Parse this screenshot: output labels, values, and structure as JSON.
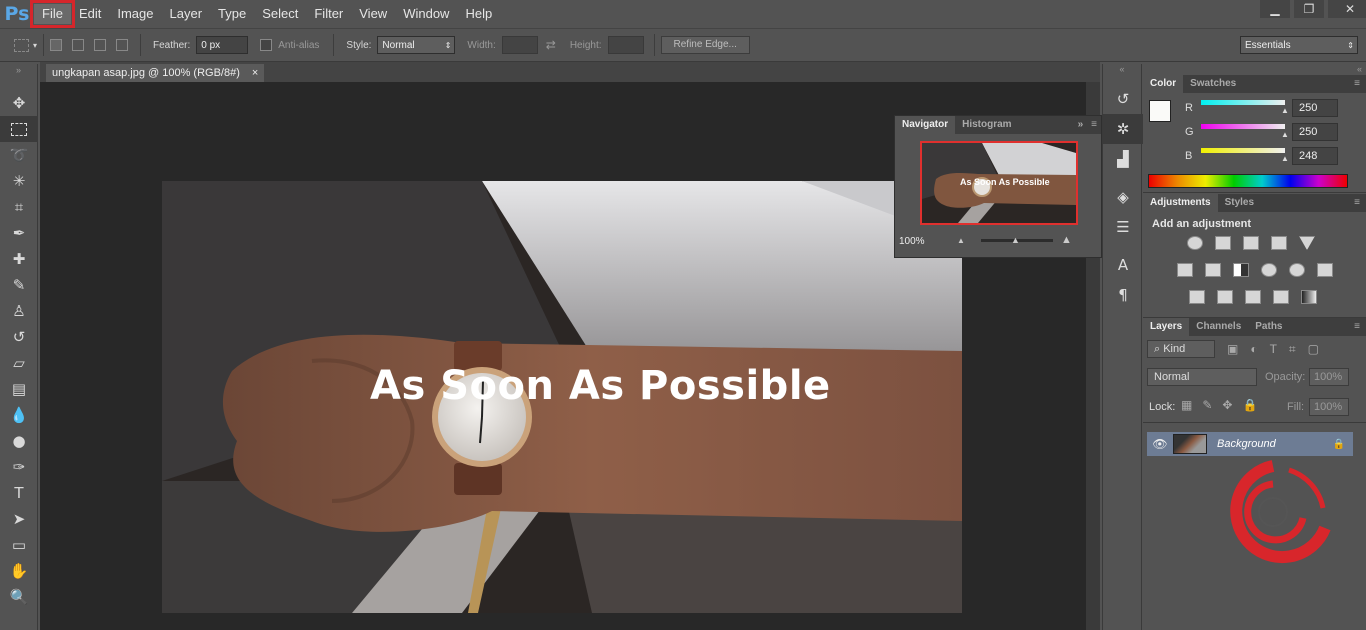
{
  "app": {
    "logo": "Ps"
  },
  "menu": [
    "File",
    "Edit",
    "Image",
    "Layer",
    "Type",
    "Select",
    "Filter",
    "View",
    "Window",
    "Help"
  ],
  "window_controls": {
    "minimize": "▁",
    "restore": "❐",
    "close": "✕"
  },
  "options": {
    "feather_label": "Feather:",
    "feather_value": "0 px",
    "antialias_label": "Anti-alias",
    "style_label": "Style:",
    "style_value": "Normal",
    "width_label": "Width:",
    "height_label": "Height:",
    "refine_label": "Refine Edge...",
    "workspace": "Essentials"
  },
  "document": {
    "tab_title": "ungkapan asap.jpg @ 100% (RGB/8#)",
    "tab_close": "×",
    "overlay_text": "As Soon As Possible"
  },
  "navigator": {
    "tabs": [
      "Navigator",
      "Histogram"
    ],
    "zoom": "100%",
    "thumb_text": "As Soon As Possible"
  },
  "color_panel": {
    "tabs": [
      "Color",
      "Swatches"
    ],
    "channels": [
      {
        "label": "R",
        "value": "250",
        "color": "#2ff0ef"
      },
      {
        "label": "G",
        "value": "250",
        "color": "#ee33ee"
      },
      {
        "label": "B",
        "value": "248",
        "color": "#f0f030"
      }
    ]
  },
  "adjustments": {
    "tabs": [
      "Adjustments",
      "Styles"
    ],
    "heading": "Add an adjustment"
  },
  "layers": {
    "tabs": [
      "Layers",
      "Channels",
      "Paths"
    ],
    "filter_kind": "Kind",
    "blend_mode": "Normal",
    "opacity_label": "Opacity:",
    "opacity_value": "100%",
    "lock_label": "Lock:",
    "fill_label": "Fill:",
    "fill_value": "100%",
    "layer_name": "Background"
  },
  "accent": {
    "highlight": "#d6262b",
    "selection": "#6d7c94"
  }
}
